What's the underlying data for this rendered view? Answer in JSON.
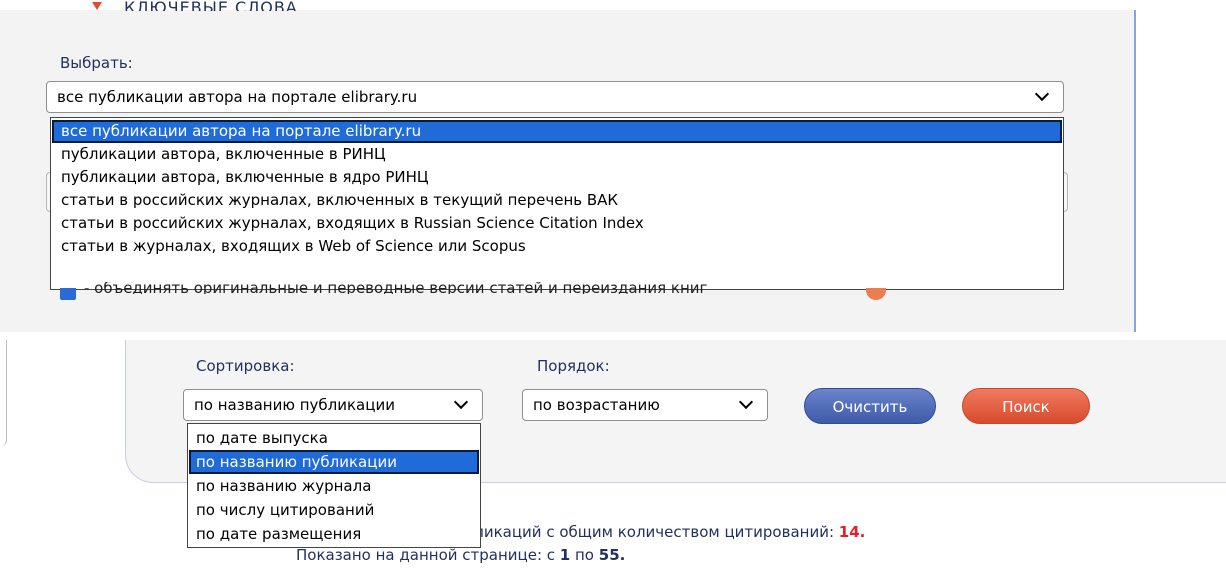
{
  "filters": {
    "keywords_label": "КЛЮЧЕВЫЕ СЛОВА",
    "choose_label": "Выбрать:",
    "selected": "все публикации автора на портале elibrary.ru",
    "options": [
      "все публикации автора на портале elibrary.ru",
      "публикации автора, включенные в РИНЦ",
      "публикации автора, включенные в ядро РИНЦ",
      "статьи в российских журналах, включенных в текущий перечень ВАК",
      "статьи в российских журналах, входящих в Russian Science Citation Index",
      "статьи в журналах, входящих в Web of Science или Scopus"
    ],
    "merge_checkbox_label": "- объединять оригинальные и переводные версии статей и переиздания книг"
  },
  "sorting": {
    "sort_label": "Сортировка:",
    "order_label": "Порядок:",
    "sort_selected": "по названию публикации",
    "order_selected": "по возрастанию",
    "sort_options": [
      "по дате выпуска",
      "по названию публикации",
      "по названию журнала",
      "по числу цитирований",
      "по дате размещения"
    ],
    "clear_label": "Очистить",
    "search_label": "Поиск"
  },
  "stats": {
    "line1_text": "бликаций с общим количеством цитирований: ",
    "citations": "14.",
    "line2_prefix": "Показано на данной странице: с ",
    "from": "1",
    "mid": " по ",
    "to": "55."
  },
  "colors": {
    "selection": "#1f6bd8",
    "accent_blue": "#3f5aa8",
    "accent_red": "#d94a2e"
  }
}
